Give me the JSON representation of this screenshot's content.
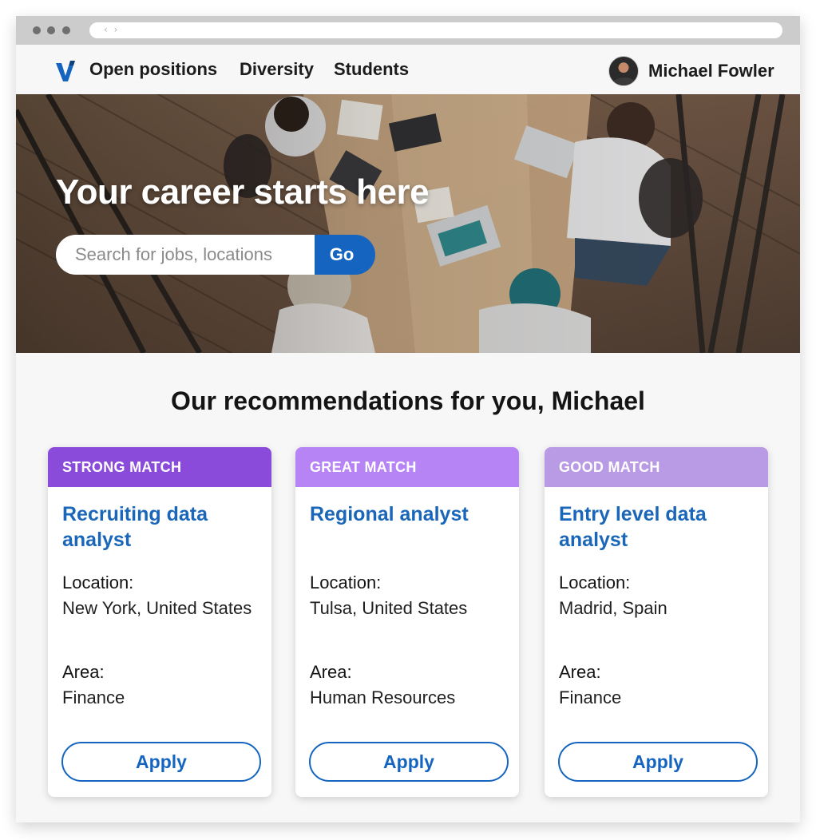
{
  "browser": {
    "nav_arrows": "‹ ›"
  },
  "nav": {
    "links": [
      "Open positions",
      "Diversity",
      "Students"
    ],
    "user_name": "Michael Fowler",
    "brand_color": "#1565c0"
  },
  "hero": {
    "title": "Your career starts here",
    "search": {
      "placeholder": "Search for jobs, locations",
      "value": "",
      "button_label": "Go"
    }
  },
  "recommendations": {
    "title": "Our recommendations for you, Michael",
    "location_label": "Location:",
    "area_label": "Area:",
    "apply_label": "Apply",
    "cards": [
      {
        "match": "STRONG MATCH",
        "match_color": "#8a4bdb",
        "job_title": "Recruiting data analyst",
        "location": "New York, United States",
        "area": "Finance"
      },
      {
        "match": "GREAT MATCH",
        "match_color": "#b784f5",
        "job_title": "Regional analyst",
        "location": "Tulsa, United States",
        "area": "Human Resources"
      },
      {
        "match": "GOOD MATCH",
        "match_color": "#b99ae4",
        "job_title": "Entry level data analyst",
        "location": "Madrid, Spain",
        "area": "Finance"
      }
    ]
  }
}
